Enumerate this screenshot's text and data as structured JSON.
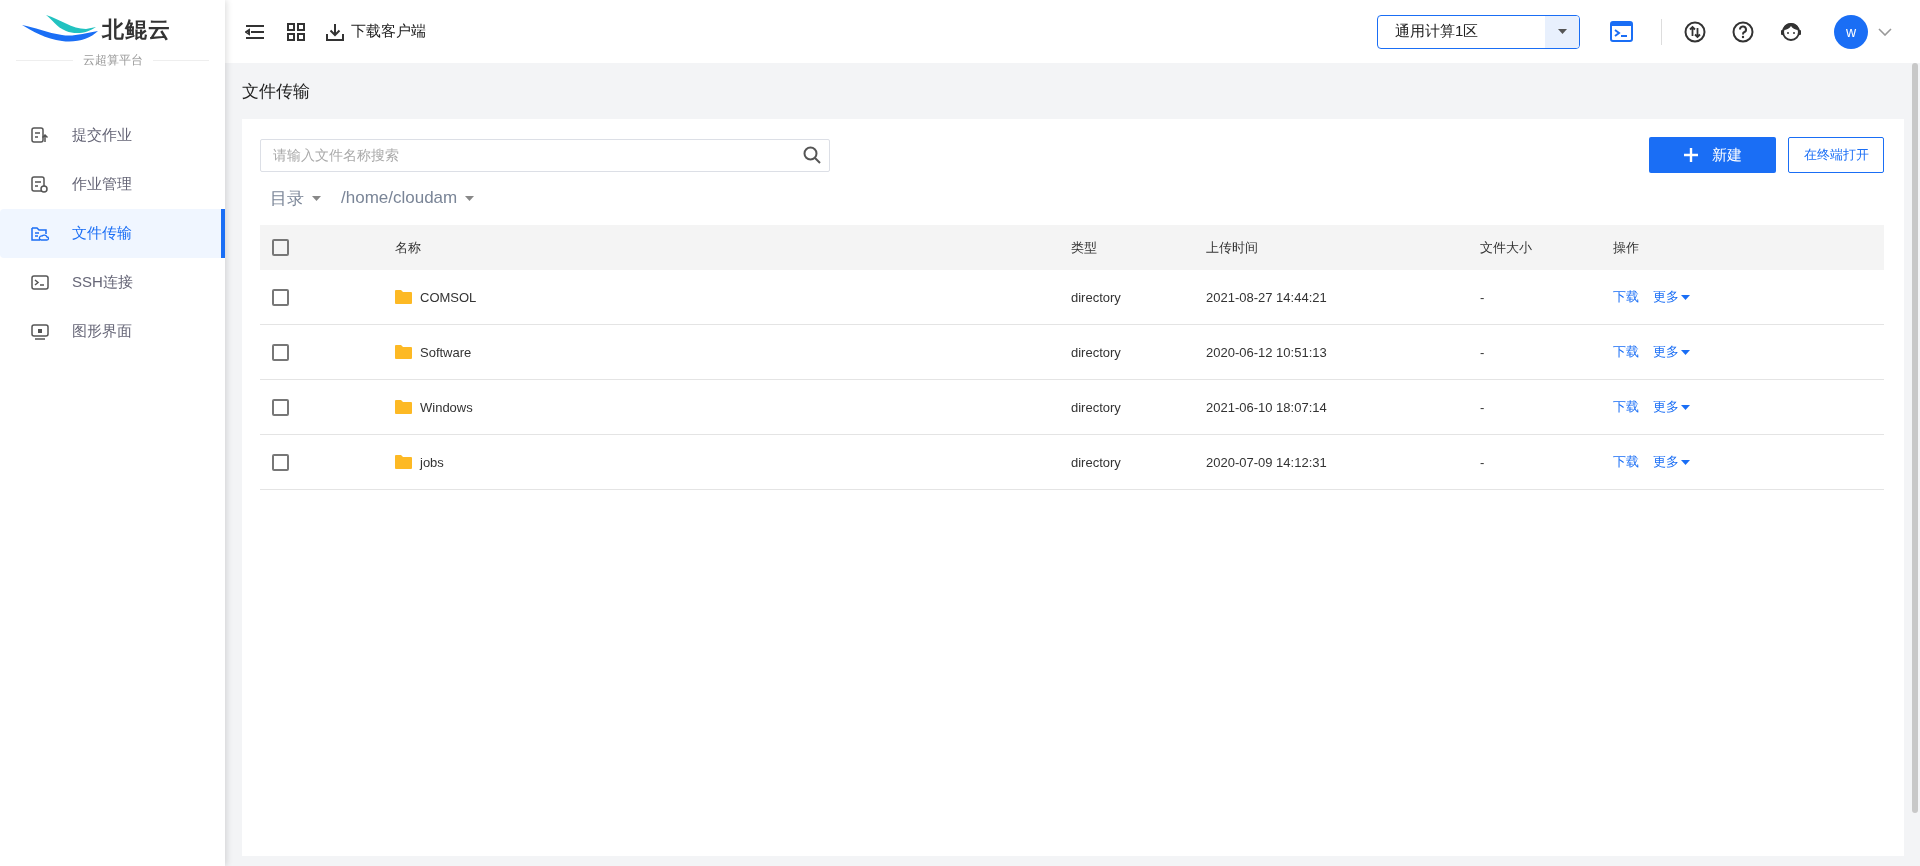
{
  "logo": {
    "name": "北鲲云",
    "tagline": "云超算平台"
  },
  "sidebar": {
    "items": [
      {
        "label": "提交作业",
        "kind": "submit",
        "selected": false
      },
      {
        "label": "作业管理",
        "kind": "manage",
        "selected": false
      },
      {
        "label": "文件传输",
        "kind": "files",
        "selected": true
      },
      {
        "label": "SSH连接",
        "kind": "terminal",
        "selected": false
      },
      {
        "label": "图形界面",
        "kind": "desktop",
        "selected": false
      }
    ]
  },
  "topbar": {
    "download_client": "下载客户端",
    "zone": "通用计算1区",
    "avatar": "w"
  },
  "page_title": "文件传输",
  "search": {
    "placeholder": "请输入文件名称搜索"
  },
  "new_button": "新建",
  "terminal_button": "在终端打开",
  "breadcrumb": [
    "目录",
    "/home/cloudam"
  ],
  "table": {
    "select_all_checked": false,
    "columns": [
      "名称",
      "类型",
      "上传时间",
      "文件大小",
      "操作"
    ],
    "rows": [
      {
        "checked": false,
        "name": "COMSOL",
        "type": "directory",
        "uploaded": "2021-08-27 14:44:21",
        "size": "-",
        "actions": [
          "下载",
          "更多"
        ]
      },
      {
        "checked": false,
        "name": "Software",
        "type": "directory",
        "uploaded": "2020-06-12 10:51:13",
        "size": "-",
        "actions": [
          "下载",
          "更多"
        ]
      },
      {
        "checked": false,
        "name": "Windows",
        "type": "directory",
        "uploaded": "2021-06-10 18:07:14",
        "size": "-",
        "actions": [
          "下载",
          "更多"
        ]
      },
      {
        "checked": false,
        "name": "jobs",
        "type": "directory",
        "uploaded": "2020-07-09 14:12:31",
        "size": "-",
        "actions": [
          "下载",
          "更多"
        ]
      }
    ]
  }
}
